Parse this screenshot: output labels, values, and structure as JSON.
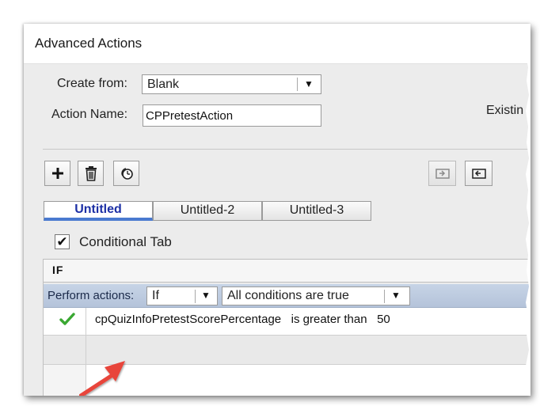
{
  "window": {
    "title": "Advanced Actions"
  },
  "form": {
    "create_from_label": "Create from:",
    "create_from_value": "Blank",
    "action_name_label": "Action Name:",
    "action_name_value": "CPPretestAction",
    "existing_label": "Existin"
  },
  "toolbar": {
    "add_icon": "plus-icon",
    "delete_icon": "trash-icon",
    "duplicate_icon": "duplicate-icon",
    "import_icon": "import-icon",
    "export_icon": "export-icon"
  },
  "tabs": [
    {
      "label": "Untitled",
      "active": true
    },
    {
      "label": "Untitled-2",
      "active": false
    },
    {
      "label": "Untitled-3",
      "active": false
    }
  ],
  "conditional": {
    "label": "Conditional Tab",
    "checked": true
  },
  "if_block": {
    "header": "IF",
    "perform_actions_label": "Perform actions:",
    "mode_value": "If",
    "condition_mode_value": "All conditions are true",
    "condition": {
      "variable": "cpQuizInfoPretestScorePercentage",
      "operator": "is greater than",
      "value": "50",
      "valid_icon": "green-check-icon"
    }
  },
  "annotation": {
    "arrow_color": "#e8443a"
  },
  "colors": {
    "active_tab_text": "#1c2fa5",
    "active_tab_underline": "#4a7ad0",
    "check_green": "#3aa832"
  }
}
